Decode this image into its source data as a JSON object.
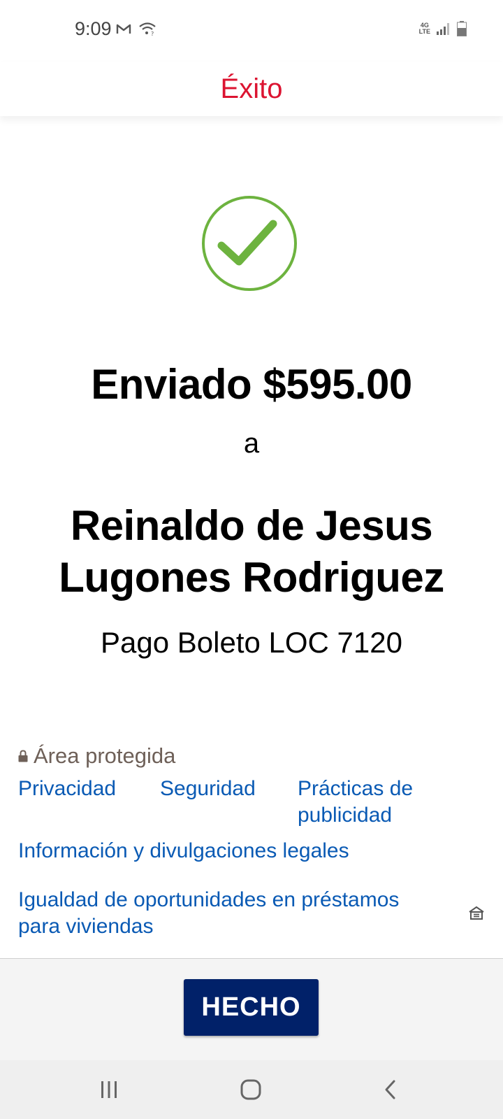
{
  "status_bar": {
    "time": "9:09",
    "icons": [
      "gmail-icon",
      "wifi-icon",
      "4g-lte-icon",
      "signal-icon",
      "battery-icon"
    ],
    "network_label_top": "4G",
    "network_label_bottom": "LTE"
  },
  "header": {
    "title": "Éxito"
  },
  "confirmation": {
    "sent_text": "Enviado $595.00",
    "to_word": "a",
    "recipient_line1": "Reinaldo de Jesus",
    "recipient_line2": "Lugones Rodriguez",
    "memo": "Pago Boleto LOC 7120",
    "check_color": "#6db33f"
  },
  "footer": {
    "protected_label": "Área protegida",
    "links": {
      "privacy": "Privacidad",
      "security": "Seguridad",
      "ad_practices_line1": "Prácticas de",
      "ad_practices_line2": "publicidad",
      "legal": "Información y divulgaciones legales",
      "equal_housing_line1": "Igualdad de oportunidades en préstamos",
      "equal_housing_line2": "para viviendas"
    }
  },
  "actions": {
    "done_label": "HECHO"
  },
  "colors": {
    "header_title": "#dc1431",
    "link": "#0a5ab4",
    "button_bg": "#012169",
    "protected_text": "#6e6058"
  },
  "nav_bar": {
    "buttons": [
      "recent-apps",
      "home",
      "back"
    ]
  }
}
